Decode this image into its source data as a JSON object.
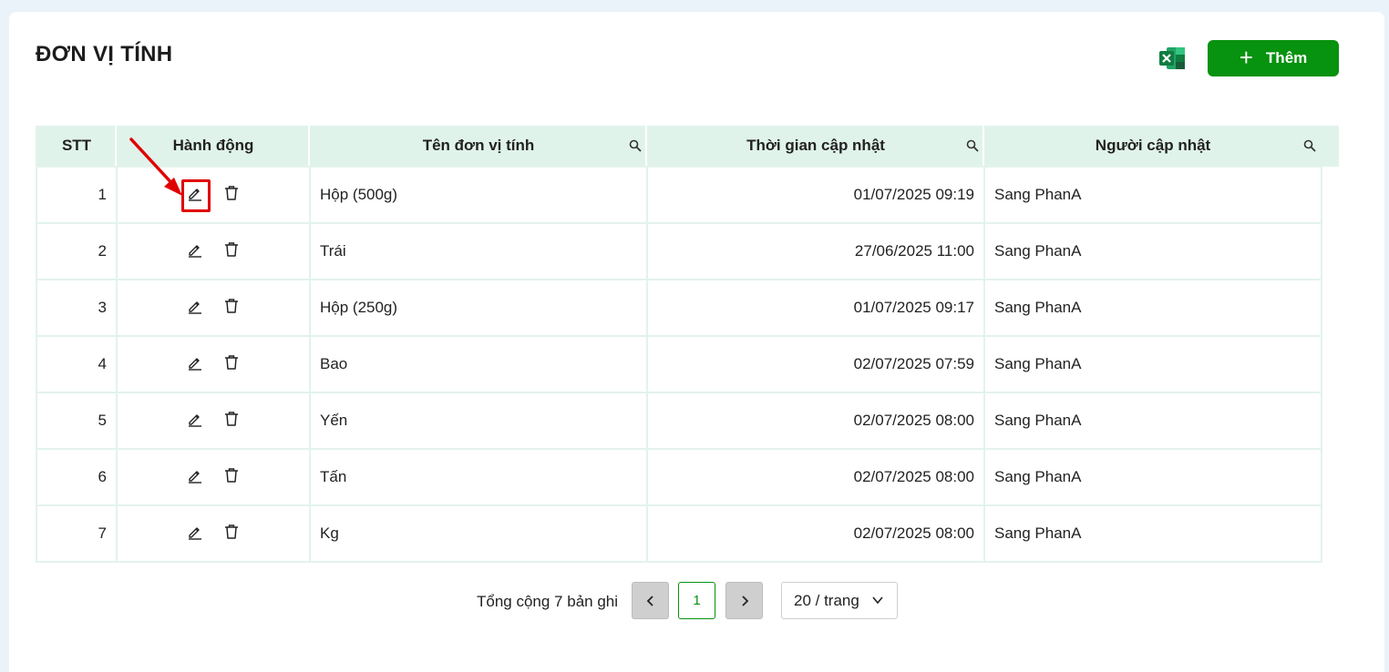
{
  "page": {
    "title": "ĐƠN VỊ TÍNH"
  },
  "toolbar": {
    "add_label": "Thêm",
    "excel_icon": "excel-export-icon"
  },
  "table": {
    "columns": {
      "stt": "STT",
      "actions": "Hành động",
      "name": "Tên đơn vị tính",
      "updated_time": "Thời gian cập nhật",
      "updated_by": "Người cập nhật"
    },
    "rows": [
      {
        "stt": "1",
        "name": "Hộp (500g)",
        "time": "01/07/2025 09:19",
        "user": "Sang PhanA"
      },
      {
        "stt": "2",
        "name": "Trái",
        "time": "27/06/2025 11:00",
        "user": "Sang PhanA"
      },
      {
        "stt": "3",
        "name": "Hộp (250g)",
        "time": "01/07/2025 09:17",
        "user": "Sang PhanA"
      },
      {
        "stt": "4",
        "name": "Bao",
        "time": "02/07/2025 07:59",
        "user": "Sang PhanA"
      },
      {
        "stt": "5",
        "name": "Yến",
        "time": "02/07/2025 08:00",
        "user": "Sang PhanA"
      },
      {
        "stt": "6",
        "name": "Tấn",
        "time": "02/07/2025 08:00",
        "user": "Sang PhanA"
      },
      {
        "stt": "7",
        "name": "Kg",
        "time": "02/07/2025 08:00",
        "user": "Sang PhanA"
      }
    ]
  },
  "pagination": {
    "total_text": "Tổng cộng 7 bản ghi",
    "current_page": "1",
    "page_size": "20 / trang"
  },
  "colors": {
    "accent": "#07920f",
    "header_bg": "#e0f3ea",
    "highlight": "#e00000"
  }
}
